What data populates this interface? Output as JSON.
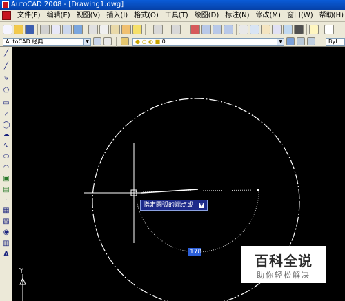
{
  "window": {
    "title": "AutoCAD 2008 - [Drawing1.dwg]"
  },
  "menu": {
    "items": [
      {
        "label": "文件(F)"
      },
      {
        "label": "编辑(E)"
      },
      {
        "label": "视图(V)"
      },
      {
        "label": "插入(I)"
      },
      {
        "label": "格式(O)"
      },
      {
        "label": "工具(T)"
      },
      {
        "label": "绘图(D)"
      },
      {
        "label": "标注(N)"
      },
      {
        "label": "修改(M)"
      },
      {
        "label": "窗口(W)"
      },
      {
        "label": "帮助(H)"
      }
    ]
  },
  "toolbar2": {
    "workspace": "AutoCAD 经典",
    "layer": "0",
    "linetype": "ByL"
  },
  "canvas": {
    "tooltip": "指定圆弧的端点或",
    "dynamic_input": "178",
    "ucs_label": "Y"
  },
  "watermark": {
    "title": "百科全说",
    "subtitle": "助你轻松解决"
  }
}
